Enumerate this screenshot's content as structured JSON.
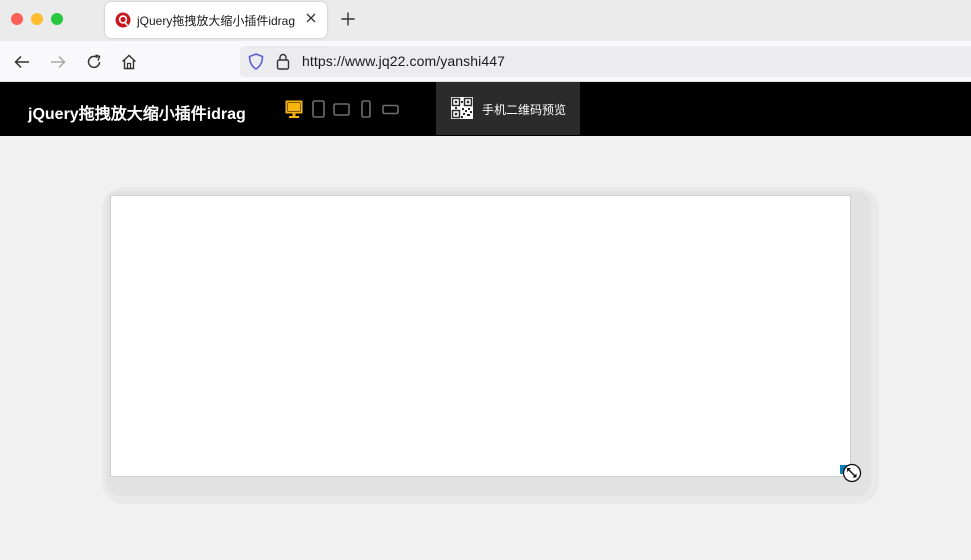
{
  "browser": {
    "tab_title": "jQuery拖拽放大缩小插件idrag",
    "url": "https://www.jq22.com/yanshi447"
  },
  "header": {
    "site_title": "jQuery拖拽放大缩小插件idrag",
    "qr_label": "手机二维码预览",
    "devices": [
      "desktop",
      "tablet-portrait",
      "tablet-landscape",
      "phone-portrait",
      "phone-landscape"
    ],
    "active_device": "desktop",
    "accent_color": "#f6b410"
  }
}
